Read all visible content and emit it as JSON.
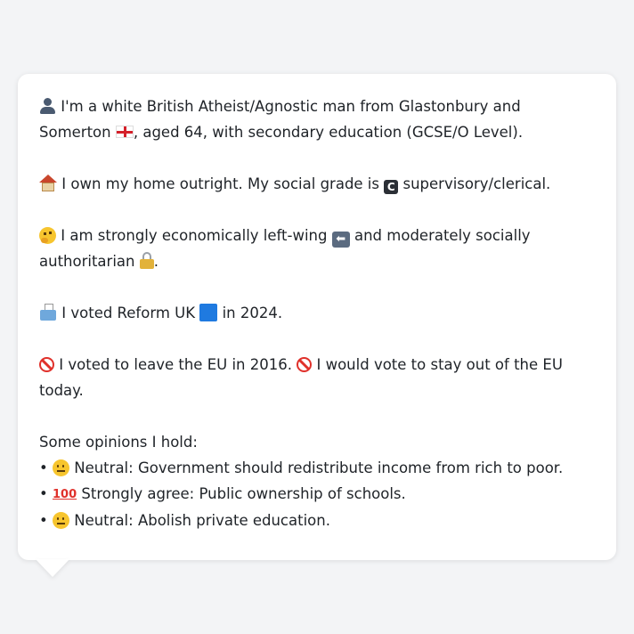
{
  "card": {
    "line1_a": "I'm a white British Atheist/Agnostic man from Glastonbury and Somerton",
    "line1_b": ", aged 64, with secondary education (GCSE/O Level).",
    "line2_a": "I own my home outright. My social grade is",
    "line2_grade": "C",
    "line2_b": "supervisory/clerical.",
    "line3_a": "I am strongly economically left-wing",
    "line3_b": "and moderately socially authoritarian",
    "line3_c": ".",
    "line4_a": "I voted Reform UK",
    "line4_b": "in 2024.",
    "line5_a": "I voted to leave the EU in 2016.",
    "line5_b": "I would vote to stay out of the EU today.",
    "opinions_title": "Some opinions I hold:",
    "opinions": [
      {
        "bullet": "•",
        "label": "Neutral: Government should redistribute income from rich to poor."
      },
      {
        "bullet": "•",
        "label": "Strongly agree: Public ownership of schools."
      },
      {
        "bullet": "•",
        "label": "Neutral: Abolish private education."
      }
    ],
    "hundred": "100"
  },
  "icons": {
    "person": "person-silhouette-icon",
    "flag": "england-flag-icon",
    "house": "house-icon",
    "grade": "letter-c-box-icon",
    "thinking": "thinking-face-icon",
    "left_arrow": "left-arrow-box-icon",
    "lock": "lock-icon",
    "ballot": "ballot-box-icon",
    "party": "blue-square-icon",
    "no_entry": "prohibited-icon",
    "neutral_face": "neutral-face-icon",
    "hundred": "hundred-points-icon"
  },
  "colors": {
    "background": "#f3f4f6",
    "card": "#ffffff",
    "text": "#1f2328",
    "reform_blue": "#1f7ae0"
  }
}
